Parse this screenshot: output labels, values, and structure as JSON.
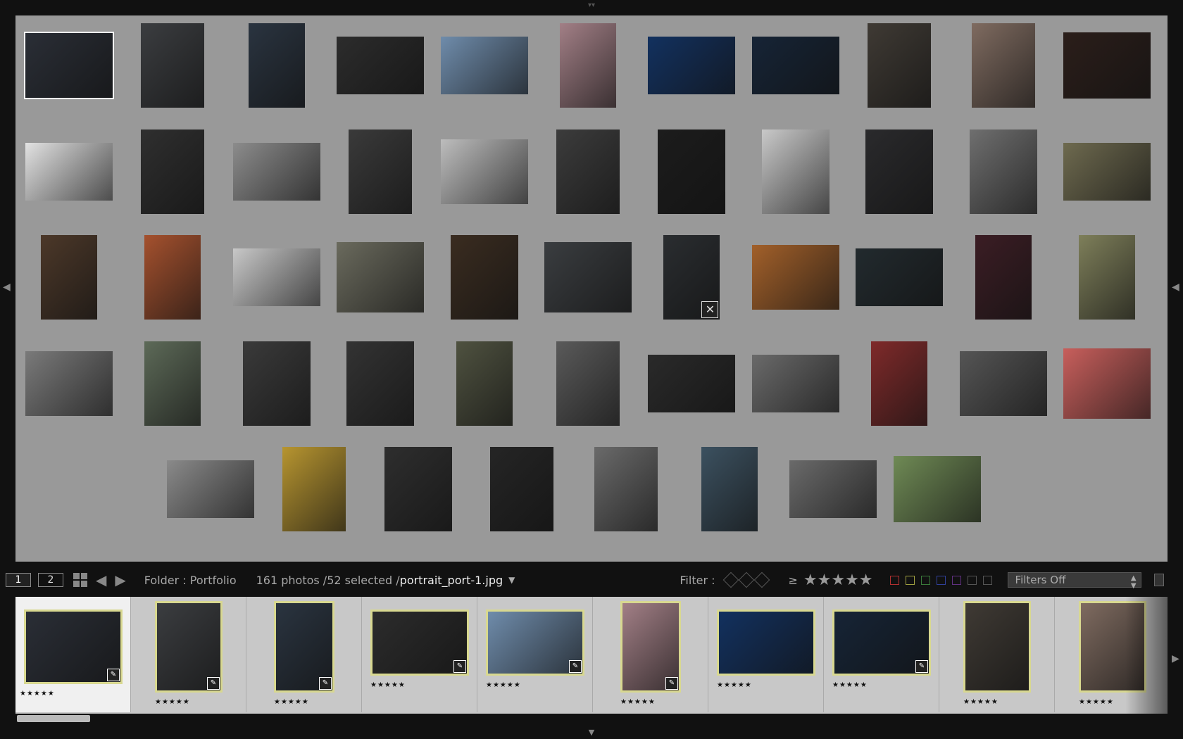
{
  "toolbar": {
    "pages": [
      "1",
      "2"
    ],
    "folder": "Folder : Portfolio",
    "count": "161 photos /52 selected /",
    "file": "portrait_port-1.jpg",
    "filter_label": "Filter :",
    "gte": "≥",
    "stars": "★★★★★",
    "filters_select": "Filters Off"
  },
  "colors": {
    "grid_bg": "#999999",
    "toolbar_bg": "#111111",
    "film_bg": "#c8c8c8",
    "film_select_border": "#d8d890",
    "label_red": "#b03030",
    "label_yellow": "#a0a040",
    "label_green": "#3a7a3a",
    "label_blue": "#30409a",
    "label_purple": "#603080"
  },
  "grid": {
    "rows": [
      [
        {
          "w": 124,
          "h": 92,
          "c": "#2a2e36",
          "selected": true
        },
        {
          "w": 90,
          "h": 120,
          "c": "#3b3d40"
        },
        {
          "w": 80,
          "h": 120,
          "c": "#2a3440"
        },
        {
          "w": 124,
          "h": 82,
          "c": "#2c2c2c"
        },
        {
          "w": 124,
          "h": 82,
          "c": "#6f8cab"
        },
        {
          "w": 80,
          "h": 120,
          "c": "#a27f86"
        },
        {
          "w": 124,
          "h": 82,
          "c": "#12315f"
        },
        {
          "w": 124,
          "h": 82,
          "c": "#162436"
        },
        {
          "w": 90,
          "h": 120,
          "c": "#3f3a34"
        },
        {
          "w": 90,
          "h": 120,
          "c": "#7f6b60"
        },
        {
          "w": 124,
          "h": 94,
          "c": "#2b1e1a"
        }
      ],
      [
        {
          "w": 124,
          "h": 82,
          "c": "#e2e2e2"
        },
        {
          "w": 90,
          "h": 120,
          "c": "#2f2f2f"
        },
        {
          "w": 124,
          "h": 82,
          "c": "#8c8c8c"
        },
        {
          "w": 90,
          "h": 120,
          "c": "#3a3a3a"
        },
        {
          "w": 124,
          "h": 92,
          "c": "#bdbdbd"
        },
        {
          "w": 90,
          "h": 120,
          "c": "#3c3c3c"
        },
        {
          "w": 96,
          "h": 120,
          "c": "#1c1c1c"
        },
        {
          "w": 96,
          "h": 120,
          "c": "#c9c9c9"
        },
        {
          "w": 96,
          "h": 120,
          "c": "#2a2a2c"
        },
        {
          "w": 96,
          "h": 120,
          "c": "#6f6f6f"
        },
        {
          "w": 124,
          "h": 82,
          "c": "#6e6a4f"
        }
      ],
      [
        {
          "w": 80,
          "h": 120,
          "c": "#4c3829"
        },
        {
          "w": 80,
          "h": 120,
          "c": "#a5512e"
        },
        {
          "w": 124,
          "h": 82,
          "c": "#c8c8c8"
        },
        {
          "w": 124,
          "h": 100,
          "c": "#6a6a5d"
        },
        {
          "w": 96,
          "h": 120,
          "c": "#3a2c20"
        },
        {
          "w": 124,
          "h": 100,
          "c": "#3a3d40"
        },
        {
          "w": 80,
          "h": 120,
          "c": "#2a2d30",
          "reject": true
        },
        {
          "w": 124,
          "h": 92,
          "c": "#a2602a"
        },
        {
          "w": 124,
          "h": 82,
          "c": "#222a2e"
        },
        {
          "w": 80,
          "h": 120,
          "c": "#3b1d24"
        },
        {
          "w": 80,
          "h": 120,
          "c": "#7e7f5a"
        }
      ],
      [
        {
          "w": 124,
          "h": 92,
          "c": "#7a7a7a"
        },
        {
          "w": 80,
          "h": 120,
          "c": "#5d6a58"
        },
        {
          "w": 96,
          "h": 120,
          "c": "#3a3a3a"
        },
        {
          "w": 96,
          "h": 120,
          "c": "#333333"
        },
        {
          "w": 80,
          "h": 120,
          "c": "#4f5240"
        },
        {
          "w": 90,
          "h": 120,
          "c": "#5a5a5a"
        },
        {
          "w": 124,
          "h": 82,
          "c": "#2a2a2a"
        },
        {
          "w": 124,
          "h": 82,
          "c": "#6a6a6a"
        },
        {
          "w": 80,
          "h": 120,
          "c": "#7f2a2a"
        },
        {
          "w": 124,
          "h": 92,
          "c": "#555555"
        },
        {
          "w": 124,
          "h": 100,
          "c": "#c85f5c"
        }
      ],
      [
        {
          "w": 124,
          "h": 82,
          "c": "#8a8a8a"
        },
        {
          "w": 90,
          "h": 120,
          "c": "#b79530"
        },
        {
          "w": 96,
          "h": 120,
          "c": "#2e2e2e"
        },
        {
          "w": 90,
          "h": 120,
          "c": "#252525"
        },
        {
          "w": 90,
          "h": 120,
          "c": "#6a6a6a"
        },
        {
          "w": 80,
          "h": 120,
          "c": "#3c5160"
        },
        {
          "w": 124,
          "h": 82,
          "c": "#6a6a6a"
        },
        {
          "w": 124,
          "h": 94,
          "c": "#6f8a55"
        }
      ]
    ]
  },
  "filmstrip": {
    "items": [
      {
        "w": 140,
        "h": 106,
        "c": "#2a2e36",
        "stars": "★★★★★",
        "badge": true,
        "active": true
      },
      {
        "w": 96,
        "h": 130,
        "c": "#3b3d40",
        "stars": "★★★★★",
        "badge": true
      },
      {
        "w": 86,
        "h": 130,
        "c": "#2a3440",
        "stars": "★★★★★",
        "badge": true
      },
      {
        "w": 140,
        "h": 94,
        "c": "#2c2c2c",
        "stars": "★★★★★",
        "badge": true
      },
      {
        "w": 140,
        "h": 94,
        "c": "#6f8cab",
        "stars": "★★★★★",
        "badge": true
      },
      {
        "w": 86,
        "h": 130,
        "c": "#a27f86",
        "stars": "★★★★★",
        "badge": true
      },
      {
        "w": 140,
        "h": 94,
        "c": "#12315f",
        "stars": "★★★★★"
      },
      {
        "w": 140,
        "h": 94,
        "c": "#162436",
        "stars": "★★★★★",
        "badge": true
      },
      {
        "w": 96,
        "h": 130,
        "c": "#3f3a34",
        "stars": "★★★★★"
      },
      {
        "w": 96,
        "h": 130,
        "c": "#7f6b60",
        "stars": "★★★★★"
      }
    ]
  }
}
